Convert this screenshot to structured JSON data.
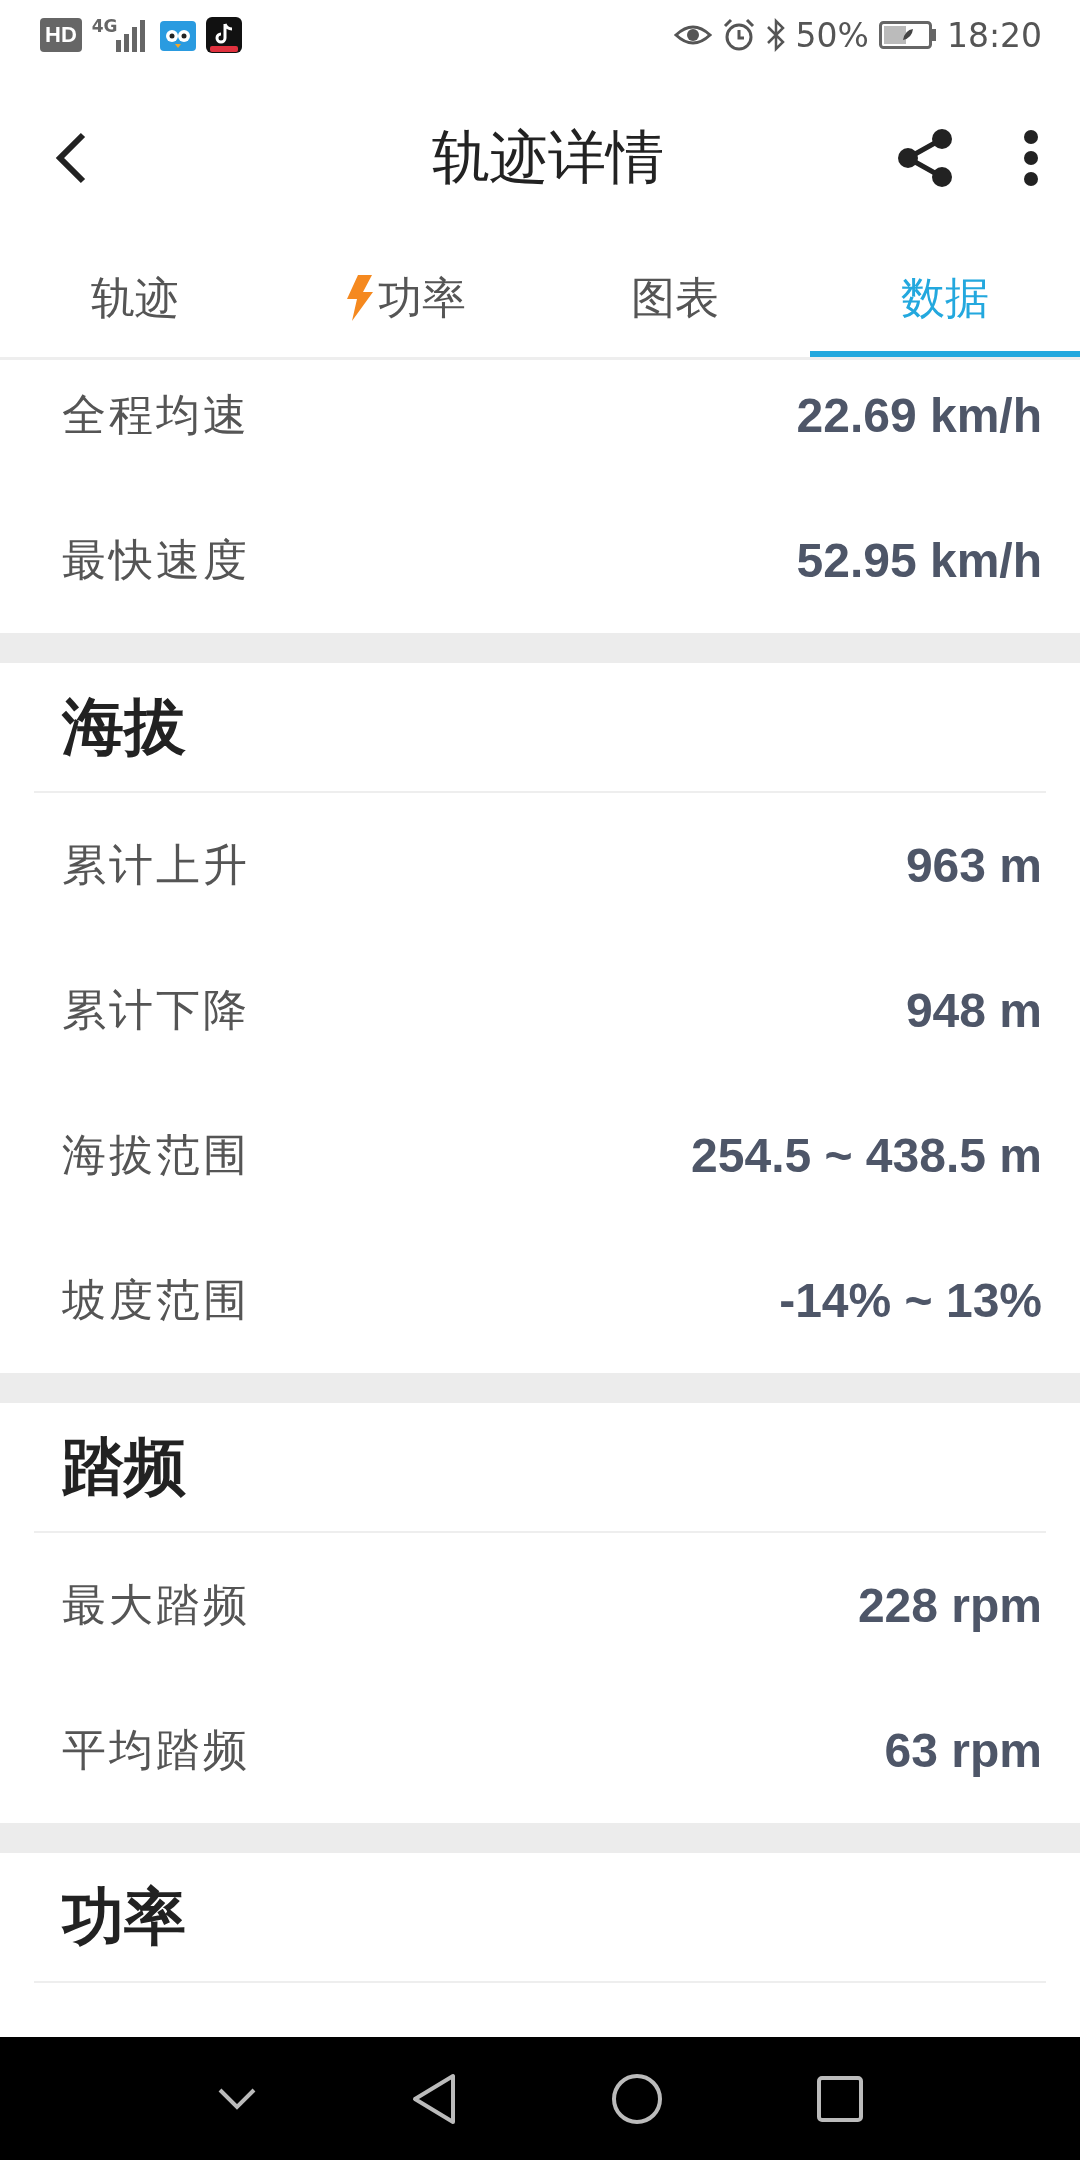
{
  "status_bar": {
    "network_badge": "HD",
    "network_type": "4G",
    "battery": "50%",
    "time": "18:20"
  },
  "app_bar": {
    "title": "轨迹详情"
  },
  "tabs": [
    {
      "label": "轨迹",
      "kind": "text",
      "selected": false
    },
    {
      "label": "功率",
      "kind": "icon",
      "selected": false
    },
    {
      "label": "图表",
      "kind": "text",
      "selected": false
    },
    {
      "label": "数据",
      "kind": "text",
      "selected": true
    }
  ],
  "sections": [
    {
      "rows": [
        {
          "label": "全程均速",
          "value": "22.69 km/h"
        },
        {
          "label": "最快速度",
          "value": "52.95 km/h"
        }
      ]
    },
    {
      "heading": "海拔",
      "rows": [
        {
          "label": "累计上升",
          "value": "963 m"
        },
        {
          "label": "累计下降",
          "value": "948 m"
        },
        {
          "label": "海拔范围",
          "value": "254.5 ~ 438.5 m"
        },
        {
          "label": "坡度范围",
          "value": "-14% ~ 13%"
        }
      ]
    },
    {
      "heading": "踏频",
      "rows": [
        {
          "label": "最大踏频",
          "value": "228 rpm"
        },
        {
          "label": "平均踏频",
          "value": "63 rpm"
        }
      ]
    },
    {
      "heading": "功率"
    }
  ]
}
